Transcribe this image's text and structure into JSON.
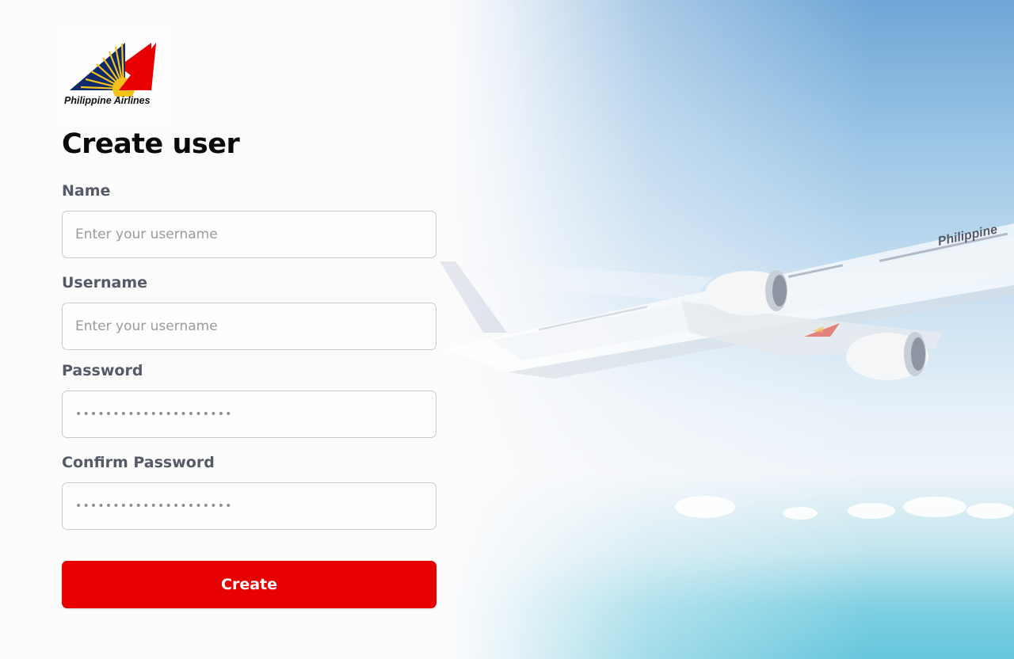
{
  "brand": {
    "logo_text": "Philippine Airlines",
    "colors": {
      "red": "#E80000",
      "navy": "#0F2A6B",
      "gold": "#F5C21B"
    }
  },
  "form": {
    "title": "Create user",
    "fields": [
      {
        "label": "Name",
        "placeholder": "Enter your username",
        "value": ""
      },
      {
        "label": "Username",
        "placeholder": "Enter your username",
        "value": ""
      },
      {
        "label": "Password",
        "masked_value": "•••••••••••••••••••••"
      },
      {
        "label": "Confirm Password",
        "masked_value": "•••••••••••••••••••••"
      }
    ],
    "submit_label": "Create"
  },
  "background": {
    "aircraft_livery_text": "Philippine"
  }
}
